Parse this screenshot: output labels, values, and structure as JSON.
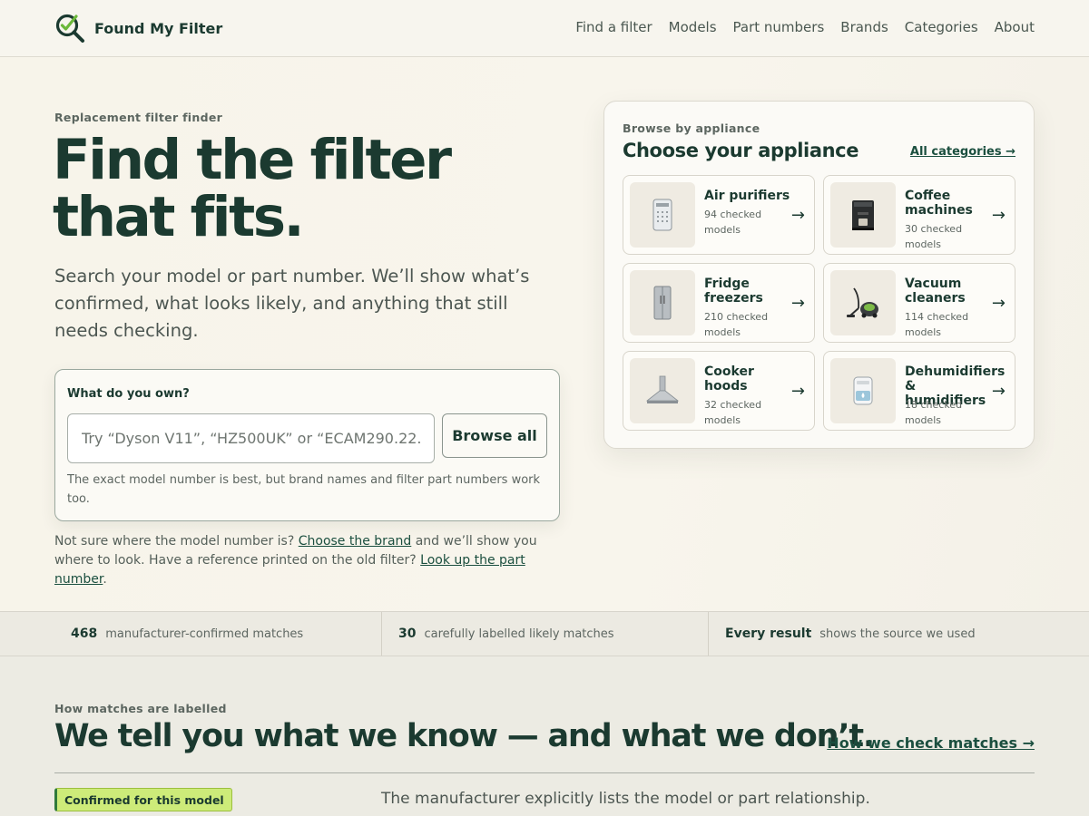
{
  "brand": {
    "name": "Found My Filter",
    "logo_icon": "magnifier-check-icon"
  },
  "nav": {
    "items": [
      "Find a filter",
      "Models",
      "Part numbers",
      "Brands",
      "Categories",
      "About"
    ]
  },
  "hero": {
    "eyebrow": "Replacement filter finder",
    "title": "Find the filter that fits.",
    "subtitle": "Search your model or part number. We’ll show what’s confirmed, what looks likely, and anything that still needs checking.",
    "search": {
      "label": "What do you own?",
      "value": "",
      "placeholder": "Try “Dyson V11”, “HZ500UK” or “ECAM290.22.B”",
      "button": "Browse all",
      "help": "The exact model number is best, but brand names and filter part numbers work too."
    },
    "note": {
      "part1": "Not sure where the model number is? ",
      "link1": "Choose the brand",
      "part2": " and we’ll show you where to look. Have a reference printed on the old filter? ",
      "link2": "Look up the part number",
      "part3": "."
    }
  },
  "appliances": {
    "eyebrow": "Browse by appliance",
    "title": "Choose your appliance",
    "link": "All categories →",
    "items": [
      {
        "name": "Air purifiers",
        "count": "94 checked models",
        "icon": "air-purifier-icon"
      },
      {
        "name": "Coffee machines",
        "count": "30 checked models",
        "icon": "coffee-machine-icon"
      },
      {
        "name": "Fridge freezers",
        "count": "210 checked models",
        "icon": "fridge-freezer-icon"
      },
      {
        "name": "Vacuum cleaners",
        "count": "114 checked models",
        "icon": "vacuum-cleaner-icon"
      },
      {
        "name": "Cooker hoods",
        "count": "32 checked models",
        "icon": "cooker-hood-icon"
      },
      {
        "name": "Dehumidifiers & humidifiers",
        "count": "18 checked models",
        "icon": "dehumidifier-icon"
      }
    ],
    "arrow": "→"
  },
  "stats": [
    {
      "num": "468",
      "text": "manufacturer-confirmed matches"
    },
    {
      "num": "30",
      "text": "carefully labelled likely matches"
    },
    {
      "num": "Every result",
      "text": "shows the source we used"
    }
  ],
  "labels": {
    "eyebrow": "How matches are labelled",
    "title": "We tell you what we know — and what we don’t.",
    "link": "How we check matches →",
    "rows": [
      {
        "badge": "Confirmed for this model",
        "description": "The manufacturer explicitly lists the model or part relationship."
      }
    ]
  },
  "colors": {
    "brand_dark": "#1b3a30",
    "badge_green": "#cdeb79",
    "page_bg": "#f8f6ef"
  }
}
